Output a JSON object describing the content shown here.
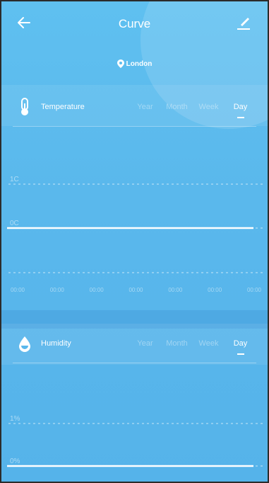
{
  "header": {
    "title": "Curve",
    "location": "London"
  },
  "temperature": {
    "label": "Temperature",
    "tabs": [
      "Year",
      "Month",
      "Week",
      "Day"
    ],
    "active_tab": "Day",
    "chart_data": {
      "type": "line",
      "x": [
        "00:00",
        "00:00",
        "00:00",
        "00:00",
        "00:00",
        "00:00",
        "00:00"
      ],
      "y_ticks": [
        "1C",
        "0C"
      ],
      "series": [
        {
          "values": [
            0,
            0,
            0,
            0,
            0,
            0,
            0
          ]
        }
      ],
      "ylim": [
        0,
        1
      ]
    }
  },
  "humidity": {
    "label": "Humidity",
    "tabs": [
      "Year",
      "Month",
      "Week",
      "Day"
    ],
    "active_tab": "Day",
    "chart_data": {
      "type": "line",
      "y_ticks": [
        "1%",
        "0%"
      ],
      "series": [
        {
          "values": [
            0,
            0,
            0,
            0,
            0,
            0,
            0
          ]
        }
      ],
      "ylim": [
        0,
        1
      ]
    }
  },
  "colors": {
    "background": "#5ab8ec",
    "band": "#4ea9e3",
    "line": "#ffffff"
  },
  "icons": {
    "back": "arrow-left-icon",
    "edit": "pen-icon",
    "location": "map-pin-icon",
    "temperature": "thermometer-icon",
    "humidity": "water-drop-icon"
  }
}
